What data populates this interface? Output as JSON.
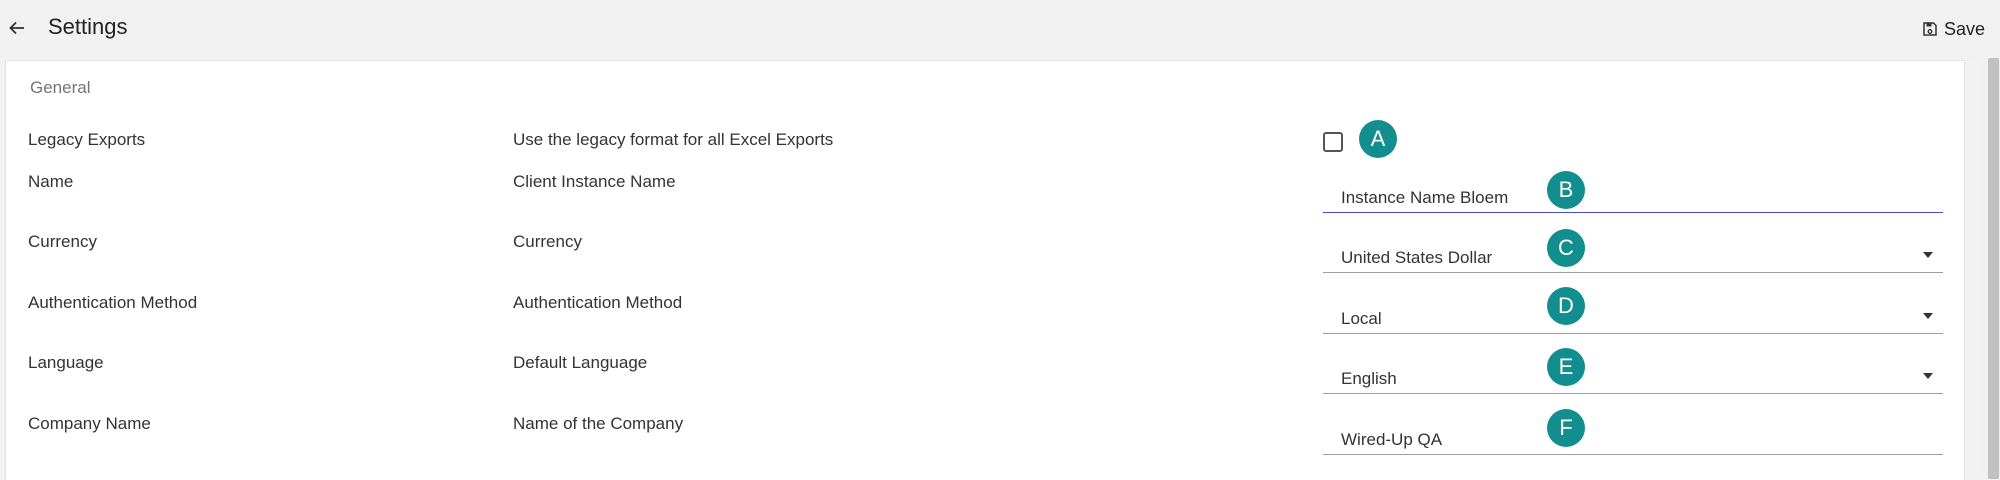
{
  "header": {
    "title": "Settings",
    "save_label": "Save"
  },
  "section": {
    "title": "General"
  },
  "rows": [
    {
      "label": "Legacy Exports",
      "description": "Use the legacy format for all Excel Exports",
      "control": "checkbox",
      "checked": false,
      "badge": "A"
    },
    {
      "label": "Name",
      "description": "Client Instance Name",
      "control": "text",
      "value": "Instance Name Bloem",
      "badge": "B"
    },
    {
      "label": "Currency",
      "description": "Currency",
      "control": "select",
      "value": "United States Dollar",
      "badge": "C"
    },
    {
      "label": "Authentication Method",
      "description": "Authentication Method",
      "control": "select",
      "value": "Local",
      "badge": "D"
    },
    {
      "label": "Language",
      "description": "Default Language",
      "control": "select",
      "value": "English",
      "badge": "E"
    },
    {
      "label": "Company Name",
      "description": "Name of the Company",
      "control": "text",
      "value": "Wired-Up QA",
      "badge": "F"
    }
  ],
  "colors": {
    "badge": "#138e8e",
    "focus_underline": "#4a4acb"
  },
  "icons": {
    "back": "arrow-left-icon",
    "save": "floppy-disk-icon",
    "dropdown": "caret-down-icon"
  }
}
